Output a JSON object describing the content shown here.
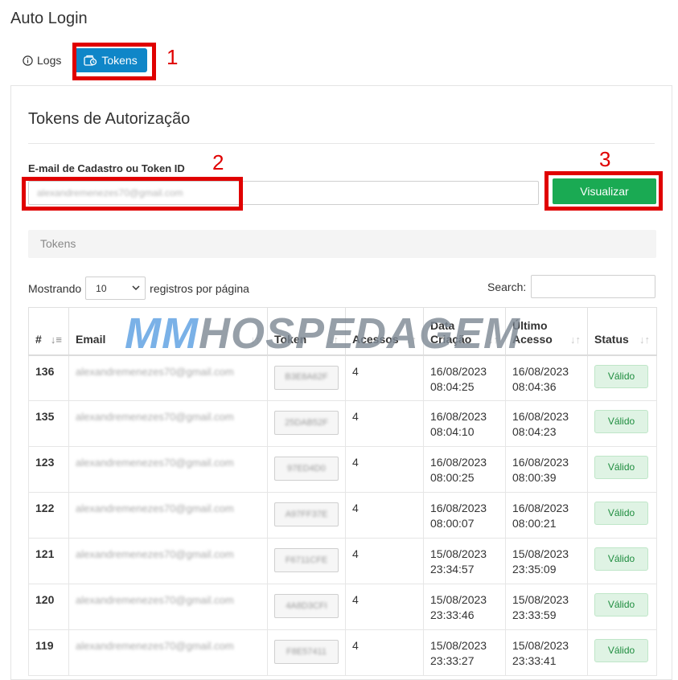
{
  "page": {
    "title": "Auto Login"
  },
  "tabs": [
    {
      "label": "Logs",
      "icon": "info-icon"
    },
    {
      "label": "Tokens",
      "icon": "tokens-icon",
      "active": true
    }
  ],
  "annotations": [
    "1",
    "2",
    "3"
  ],
  "card": {
    "title": "Tokens de Autorização",
    "field_label": "E-mail de Cadastro ou Token ID",
    "field_value": "alexandremenezes70@gmail.com",
    "view_button": "Visualizar",
    "panel_title": "Tokens"
  },
  "table_controls": {
    "show_prefix": "Mostrando",
    "page_size": "10",
    "show_suffix": "registros por página",
    "search_label": "Search:"
  },
  "table": {
    "columns": [
      "#",
      "Email",
      "Token",
      "Acessos",
      "Data Criação",
      "Último Acesso",
      "Status"
    ],
    "rows": [
      {
        "id": "136",
        "email": "alexandremenezes70@gmail.com",
        "token": "B3E8A62F",
        "acessos": "4",
        "criado_data": "16/08/2023",
        "criado_hora": "08:04:25",
        "ultimo_data": "16/08/2023",
        "ultimo_hora": "08:04:36",
        "status": "Válido"
      },
      {
        "id": "135",
        "email": "alexandremenezes70@gmail.com",
        "token": "25DAB52F",
        "acessos": "4",
        "criado_data": "16/08/2023",
        "criado_hora": "08:04:10",
        "ultimo_data": "16/08/2023",
        "ultimo_hora": "08:04:23",
        "status": "Válido"
      },
      {
        "id": "123",
        "email": "alexandremenezes70@gmail.com",
        "token": "97ED4D0",
        "acessos": "4",
        "criado_data": "16/08/2023",
        "criado_hora": "08:00:25",
        "ultimo_data": "16/08/2023",
        "ultimo_hora": "08:00:39",
        "status": "Válido"
      },
      {
        "id": "122",
        "email": "alexandremenezes70@gmail.com",
        "token": "A97FF37E",
        "acessos": "4",
        "criado_data": "16/08/2023",
        "criado_hora": "08:00:07",
        "ultimo_data": "16/08/2023",
        "ultimo_hora": "08:00:21",
        "status": "Válido"
      },
      {
        "id": "121",
        "email": "alexandremenezes70@gmail.com",
        "token": "F6711CFE",
        "acessos": "4",
        "criado_data": "15/08/2023",
        "criado_hora": "23:34:57",
        "ultimo_data": "15/08/2023",
        "ultimo_hora": "23:35:09",
        "status": "Válido"
      },
      {
        "id": "120",
        "email": "alexandremenezes70@gmail.com",
        "token": "4A8D3CFI",
        "acessos": "4",
        "criado_data": "15/08/2023",
        "criado_hora": "23:33:46",
        "ultimo_data": "15/08/2023",
        "ultimo_hora": "23:33:59",
        "status": "Válido"
      },
      {
        "id": "119",
        "email": "alexandremenezes70@gmail.com",
        "token": "F8E57411",
        "acessos": "4",
        "criado_data": "15/08/2023",
        "criado_hora": "23:33:27",
        "ultimo_data": "15/08/2023",
        "ultimo_hora": "23:33:41",
        "status": "Válido"
      }
    ]
  },
  "watermark": {
    "part1": "MM",
    "part2": "HOSPEDAGEM"
  },
  "colors": {
    "accent": "#0f86c8",
    "primary_button": "#1aaa53",
    "highlight": "#e00000",
    "badge_bg": "#dff3e4",
    "badge_text": "#1f8d3f"
  }
}
